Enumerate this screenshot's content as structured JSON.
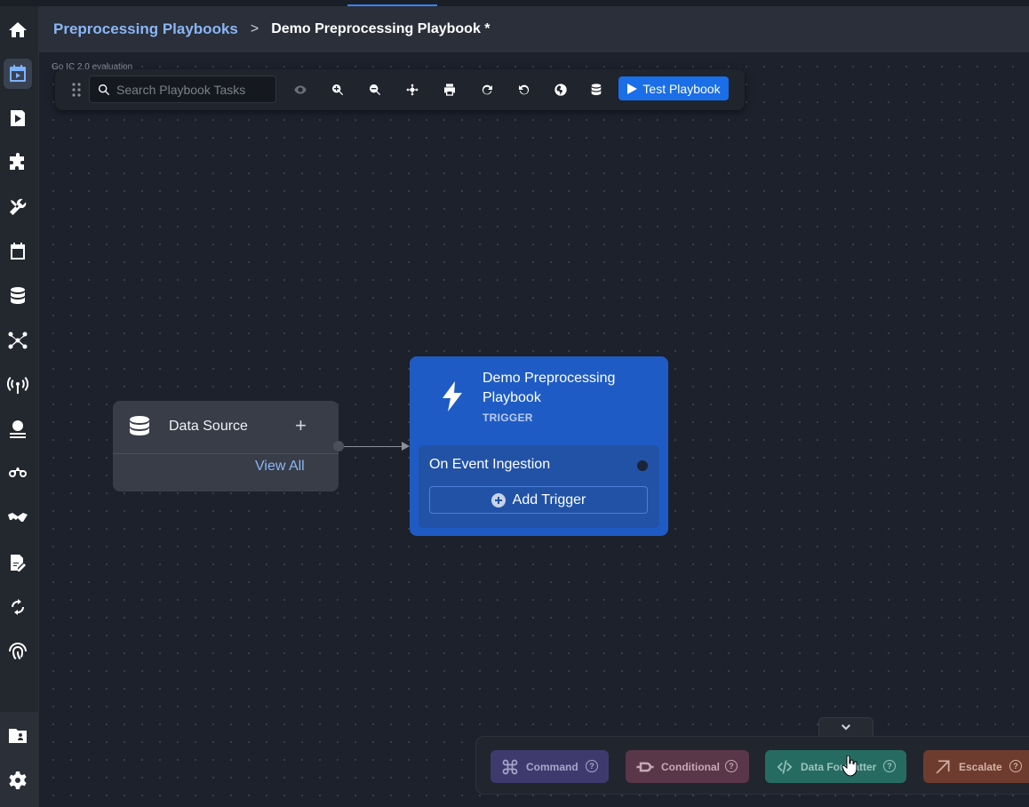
{
  "breadcrumb": {
    "parent": "Preprocessing Playbooks",
    "separator": ">",
    "current": "Demo Preprocessing Playbook *"
  },
  "sidebar": {
    "items": [
      {
        "icon": "home-icon"
      },
      {
        "icon": "playbooks-calendar-icon",
        "active": true
      },
      {
        "icon": "play-icon"
      },
      {
        "icon": "puzzle-icon"
      },
      {
        "icon": "tools-icon"
      },
      {
        "icon": "calendar-icon"
      },
      {
        "icon": "database-icon"
      },
      {
        "icon": "network-icon"
      },
      {
        "icon": "antenna-icon"
      },
      {
        "icon": "globe-user-icon"
      },
      {
        "icon": "binoculars-icon"
      },
      {
        "icon": "handshake-icon"
      },
      {
        "icon": "document-edit-icon"
      },
      {
        "icon": "sync-icon"
      },
      {
        "icon": "fingerprint-icon"
      }
    ],
    "bottom": [
      {
        "icon": "folder-user-icon"
      },
      {
        "icon": "settings-gear-icon"
      }
    ]
  },
  "toolbar": {
    "search_placeholder": "Search Playbook Tasks",
    "buttons": [
      "eye-icon",
      "zoom-in-icon",
      "zoom-out-icon",
      "fit-view-icon",
      "print-icon",
      "redo-icon",
      "undo-icon",
      "globe-icon",
      "database-icon"
    ],
    "test_label": "Test Playbook",
    "accent": "#1a6ee8"
  },
  "canvas": {
    "ghost_text": "Go IC 2.0 evaluation"
  },
  "nodes": {
    "data_source": {
      "title": "Data Source",
      "plus": "+",
      "view_all": "View All"
    },
    "trigger": {
      "title": "Demo Preprocessing Playbook",
      "type": "TRIGGER",
      "event": "On Event Ingestion",
      "add_label": "Add Trigger",
      "color": "#1f5bc4"
    }
  },
  "palette": {
    "items": [
      {
        "label": "Command",
        "icon": "command-icon",
        "color": "#3f3a6e"
      },
      {
        "label": "Conditional",
        "icon": "conditional-icon",
        "color": "#5a3649"
      },
      {
        "label": "Data Formatter",
        "icon": "code-icon",
        "color": "#266b61"
      },
      {
        "label": "Escalate",
        "icon": "arrow-up-right-icon",
        "color": "#6e3c2e"
      }
    ],
    "help": "?"
  }
}
